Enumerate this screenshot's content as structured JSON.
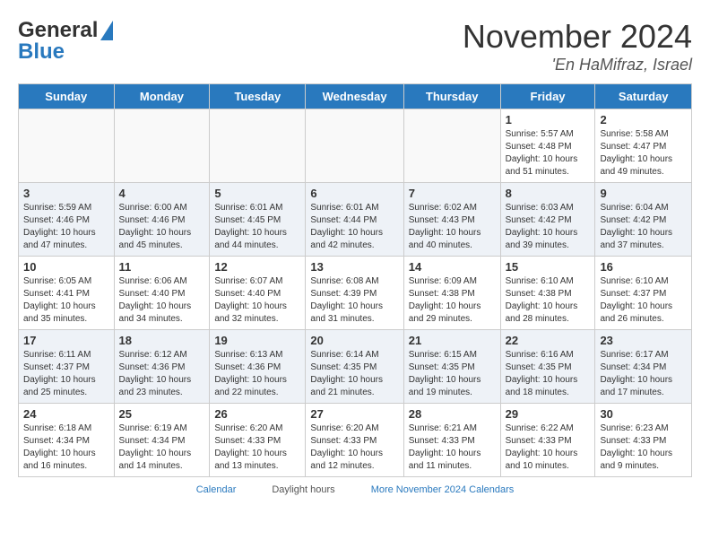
{
  "header": {
    "logo_line1": "General",
    "logo_line2": "Blue",
    "month_title": "November 2024",
    "location": "'En HaMifraz, Israel"
  },
  "columns": [
    "Sunday",
    "Monday",
    "Tuesday",
    "Wednesday",
    "Thursday",
    "Friday",
    "Saturday"
  ],
  "weeks": [
    [
      {
        "day": "",
        "info": ""
      },
      {
        "day": "",
        "info": ""
      },
      {
        "day": "",
        "info": ""
      },
      {
        "day": "",
        "info": ""
      },
      {
        "day": "",
        "info": ""
      },
      {
        "day": "1",
        "info": "Sunrise: 5:57 AM\nSunset: 4:48 PM\nDaylight: 10 hours and 51 minutes."
      },
      {
        "day": "2",
        "info": "Sunrise: 5:58 AM\nSunset: 4:47 PM\nDaylight: 10 hours and 49 minutes."
      }
    ],
    [
      {
        "day": "3",
        "info": "Sunrise: 5:59 AM\nSunset: 4:46 PM\nDaylight: 10 hours and 47 minutes."
      },
      {
        "day": "4",
        "info": "Sunrise: 6:00 AM\nSunset: 4:46 PM\nDaylight: 10 hours and 45 minutes."
      },
      {
        "day": "5",
        "info": "Sunrise: 6:01 AM\nSunset: 4:45 PM\nDaylight: 10 hours and 44 minutes."
      },
      {
        "day": "6",
        "info": "Sunrise: 6:01 AM\nSunset: 4:44 PM\nDaylight: 10 hours and 42 minutes."
      },
      {
        "day": "7",
        "info": "Sunrise: 6:02 AM\nSunset: 4:43 PM\nDaylight: 10 hours and 40 minutes."
      },
      {
        "day": "8",
        "info": "Sunrise: 6:03 AM\nSunset: 4:42 PM\nDaylight: 10 hours and 39 minutes."
      },
      {
        "day": "9",
        "info": "Sunrise: 6:04 AM\nSunset: 4:42 PM\nDaylight: 10 hours and 37 minutes."
      }
    ],
    [
      {
        "day": "10",
        "info": "Sunrise: 6:05 AM\nSunset: 4:41 PM\nDaylight: 10 hours and 35 minutes."
      },
      {
        "day": "11",
        "info": "Sunrise: 6:06 AM\nSunset: 4:40 PM\nDaylight: 10 hours and 34 minutes."
      },
      {
        "day": "12",
        "info": "Sunrise: 6:07 AM\nSunset: 4:40 PM\nDaylight: 10 hours and 32 minutes."
      },
      {
        "day": "13",
        "info": "Sunrise: 6:08 AM\nSunset: 4:39 PM\nDaylight: 10 hours and 31 minutes."
      },
      {
        "day": "14",
        "info": "Sunrise: 6:09 AM\nSunset: 4:38 PM\nDaylight: 10 hours and 29 minutes."
      },
      {
        "day": "15",
        "info": "Sunrise: 6:10 AM\nSunset: 4:38 PM\nDaylight: 10 hours and 28 minutes."
      },
      {
        "day": "16",
        "info": "Sunrise: 6:10 AM\nSunset: 4:37 PM\nDaylight: 10 hours and 26 minutes."
      }
    ],
    [
      {
        "day": "17",
        "info": "Sunrise: 6:11 AM\nSunset: 4:37 PM\nDaylight: 10 hours and 25 minutes."
      },
      {
        "day": "18",
        "info": "Sunrise: 6:12 AM\nSunset: 4:36 PM\nDaylight: 10 hours and 23 minutes."
      },
      {
        "day": "19",
        "info": "Sunrise: 6:13 AM\nSunset: 4:36 PM\nDaylight: 10 hours and 22 minutes."
      },
      {
        "day": "20",
        "info": "Sunrise: 6:14 AM\nSunset: 4:35 PM\nDaylight: 10 hours and 21 minutes."
      },
      {
        "day": "21",
        "info": "Sunrise: 6:15 AM\nSunset: 4:35 PM\nDaylight: 10 hours and 19 minutes."
      },
      {
        "day": "22",
        "info": "Sunrise: 6:16 AM\nSunset: 4:35 PM\nDaylight: 10 hours and 18 minutes."
      },
      {
        "day": "23",
        "info": "Sunrise: 6:17 AM\nSunset: 4:34 PM\nDaylight: 10 hours and 17 minutes."
      }
    ],
    [
      {
        "day": "24",
        "info": "Sunrise: 6:18 AM\nSunset: 4:34 PM\nDaylight: 10 hours and 16 minutes."
      },
      {
        "day": "25",
        "info": "Sunrise: 6:19 AM\nSunset: 4:34 PM\nDaylight: 10 hours and 14 minutes."
      },
      {
        "day": "26",
        "info": "Sunrise: 6:20 AM\nSunset: 4:33 PM\nDaylight: 10 hours and 13 minutes."
      },
      {
        "day": "27",
        "info": "Sunrise: 6:20 AM\nSunset: 4:33 PM\nDaylight: 10 hours and 12 minutes."
      },
      {
        "day": "28",
        "info": "Sunrise: 6:21 AM\nSunset: 4:33 PM\nDaylight: 10 hours and 11 minutes."
      },
      {
        "day": "29",
        "info": "Sunrise: 6:22 AM\nSunset: 4:33 PM\nDaylight: 10 hours and 10 minutes."
      },
      {
        "day": "30",
        "info": "Sunrise: 6:23 AM\nSunset: 4:33 PM\nDaylight: 10 hours and 9 minutes."
      }
    ]
  ],
  "footer": {
    "calendar_link": "Calendar",
    "more_link": "More November 2024 Calendars",
    "daylight_label": "Daylight hours"
  }
}
